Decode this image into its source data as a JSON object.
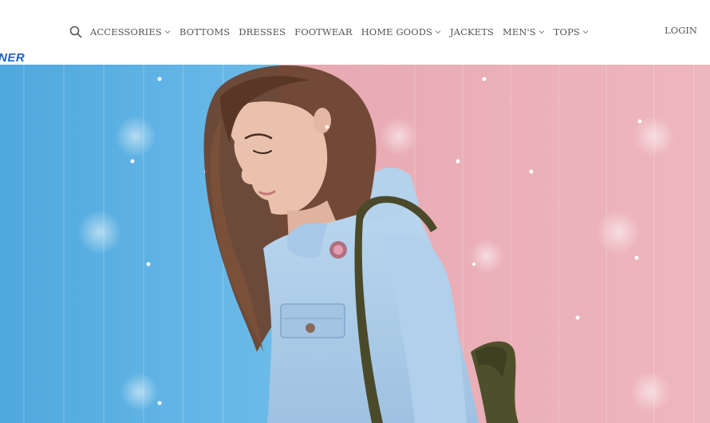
{
  "brand": {
    "logo_text": "NER"
  },
  "nav": {
    "search_icon": "search-icon",
    "items": [
      {
        "label": "ACCESSORIES",
        "dropdown": true
      },
      {
        "label": "BOTTOMS",
        "dropdown": false
      },
      {
        "label": "DRESSES",
        "dropdown": false
      },
      {
        "label": "FOOTWEAR",
        "dropdown": false
      },
      {
        "label": "HOME GOODS",
        "dropdown": true
      },
      {
        "label": "JACKETS",
        "dropdown": false
      },
      {
        "label": "MEN'S",
        "dropdown": true
      },
      {
        "label": "TOPS",
        "dropdown": true
      }
    ],
    "login_label": "LOGIN"
  },
  "hero": {
    "image": "woman-denim-jacket-photo",
    "colors": {
      "left_wall": "#5fb4e4",
      "right_wall": "#ebb0b8",
      "jacket": "#a9cbe8",
      "hair": "#6b4330",
      "strap": "#4a4a2a"
    }
  },
  "colors": {
    "brand": "#1e63c6",
    "nav_text": "#555555"
  }
}
